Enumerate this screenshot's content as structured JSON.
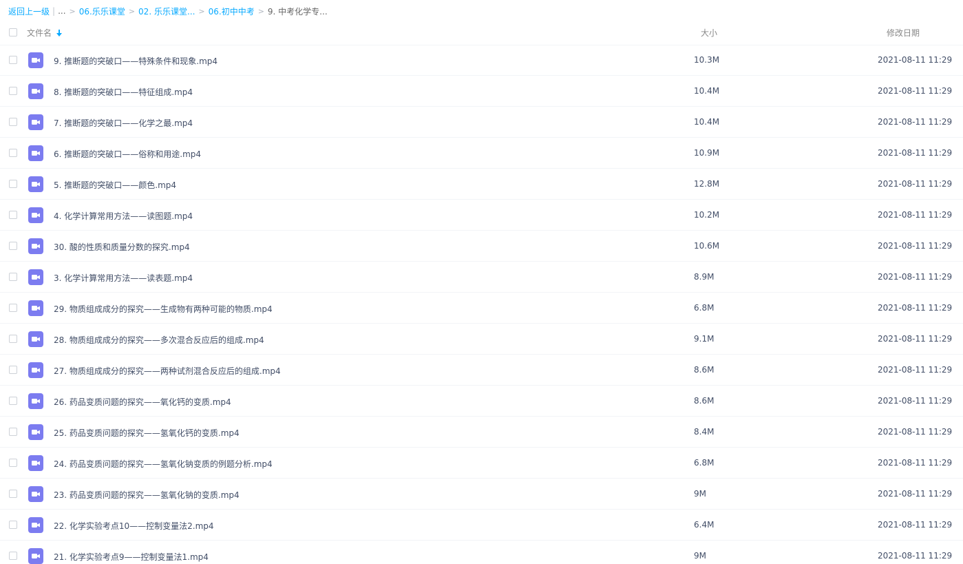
{
  "breadcrumb": {
    "back": "返回上一级",
    "pipe": "|",
    "ellipsis": "...",
    "sep": ">",
    "items": [
      "06.乐乐课堂",
      "02. 乐乐课堂...",
      "06.初中中考"
    ],
    "current": "9. 中考化学专..."
  },
  "header": {
    "name": "文件名",
    "size": "大小",
    "date": "修改日期",
    "sort_icon": "arrow-down-icon"
  },
  "colors": {
    "accent": "#09aaff",
    "video_icon": "#7c7cf0"
  },
  "files": [
    {
      "name": "9. 推断题的突破口——特殊条件和现象.mp4",
      "size": "10.3M",
      "date": "2021-08-11 11:29",
      "icon": "video-file-icon"
    },
    {
      "name": "8. 推断题的突破口——特征组成.mp4",
      "size": "10.4M",
      "date": "2021-08-11 11:29",
      "icon": "video-file-icon"
    },
    {
      "name": "7. 推断题的突破口——化学之最.mp4",
      "size": "10.4M",
      "date": "2021-08-11 11:29",
      "icon": "video-file-icon"
    },
    {
      "name": "6. 推断题的突破口——俗称和用途.mp4",
      "size": "10.9M",
      "date": "2021-08-11 11:29",
      "icon": "video-file-icon"
    },
    {
      "name": "5. 推断题的突破口——颜色.mp4",
      "size": "12.8M",
      "date": "2021-08-11 11:29",
      "icon": "video-file-icon"
    },
    {
      "name": "4. 化学计算常用方法——读图题.mp4",
      "size": "10.2M",
      "date": "2021-08-11 11:29",
      "icon": "video-file-icon"
    },
    {
      "name": "30. 酸的性质和质量分数的探究.mp4",
      "size": "10.6M",
      "date": "2021-08-11 11:29",
      "icon": "video-file-icon"
    },
    {
      "name": "3. 化学计算常用方法——读表题.mp4",
      "size": "8.9M",
      "date": "2021-08-11 11:29",
      "icon": "video-file-icon"
    },
    {
      "name": "29. 物质组成成分的探究——生成物有两种可能的物质.mp4",
      "size": "6.8M",
      "date": "2021-08-11 11:29",
      "icon": "video-file-icon"
    },
    {
      "name": "28. 物质组成成分的探究——多次混合反应后的组成.mp4",
      "size": "9.1M",
      "date": "2021-08-11 11:29",
      "icon": "video-file-icon"
    },
    {
      "name": "27. 物质组成成分的探究——两种试剂混合反应后的组成.mp4",
      "size": "8.6M",
      "date": "2021-08-11 11:29",
      "icon": "video-file-icon"
    },
    {
      "name": "26. 药品变质问题的探究——氧化钙的变质.mp4",
      "size": "8.6M",
      "date": "2021-08-11 11:29",
      "icon": "video-file-icon"
    },
    {
      "name": "25. 药品变质问题的探究——氢氧化钙的变质.mp4",
      "size": "8.4M",
      "date": "2021-08-11 11:29",
      "icon": "video-file-icon"
    },
    {
      "name": "24. 药品变质问题的探究——氢氧化钠变质的例题分析.mp4",
      "size": "6.8M",
      "date": "2021-08-11 11:29",
      "icon": "video-file-icon"
    },
    {
      "name": "23. 药品变质问题的探究——氢氧化钠的变质.mp4",
      "size": "9M",
      "date": "2021-08-11 11:29",
      "icon": "video-file-icon"
    },
    {
      "name": "22. 化学实验考点10——控制变量法2.mp4",
      "size": "6.4M",
      "date": "2021-08-11 11:29",
      "icon": "video-file-icon"
    },
    {
      "name": "21. 化学实验考点9——控制变量法1.mp4",
      "size": "9M",
      "date": "2021-08-11 11:29",
      "icon": "video-file-icon"
    }
  ]
}
